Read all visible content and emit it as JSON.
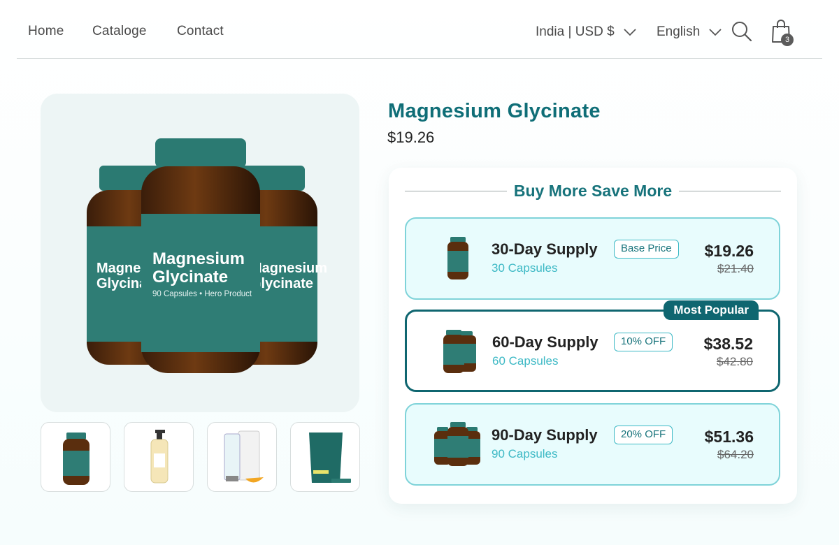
{
  "nav": {
    "links": [
      "Home",
      "Cataloge",
      "Contact"
    ],
    "region": "India | USD $",
    "language": "English",
    "cart_count": "3"
  },
  "product": {
    "title": "Magnesium Glycinate",
    "price": "$19.26",
    "label_name_line1": "Magnesium",
    "label_name_line2": "Glycinate",
    "label_sub": "90 Capsules • Hero Product"
  },
  "bundles": {
    "heading": "Buy More Save More",
    "options": [
      {
        "title": "30-Day Supply",
        "tag": "Base Price",
        "subtitle": "30 Capsules",
        "price": "$19.26",
        "old_price": "$21.40"
      },
      {
        "title": "60-Day Supply",
        "tag": "10% OFF",
        "subtitle": "60 Capsules",
        "price": "$38.52",
        "old_price": "$42.80",
        "ribbon": "Most Popular",
        "selected": true
      },
      {
        "title": "90-Day Supply",
        "tag": "20% OFF",
        "subtitle": "90 Capsules",
        "price": "$51.36",
        "old_price": "$64.20"
      }
    ]
  },
  "colors": {
    "brand_teal": "#0f6e77",
    "accent_cyan": "#3db9c5",
    "option_bg": "#e8fcfd",
    "bottle_label": "#2b7a72"
  },
  "icons": [
    "chevron-down-icon",
    "search-icon",
    "shopping-bag-icon"
  ]
}
